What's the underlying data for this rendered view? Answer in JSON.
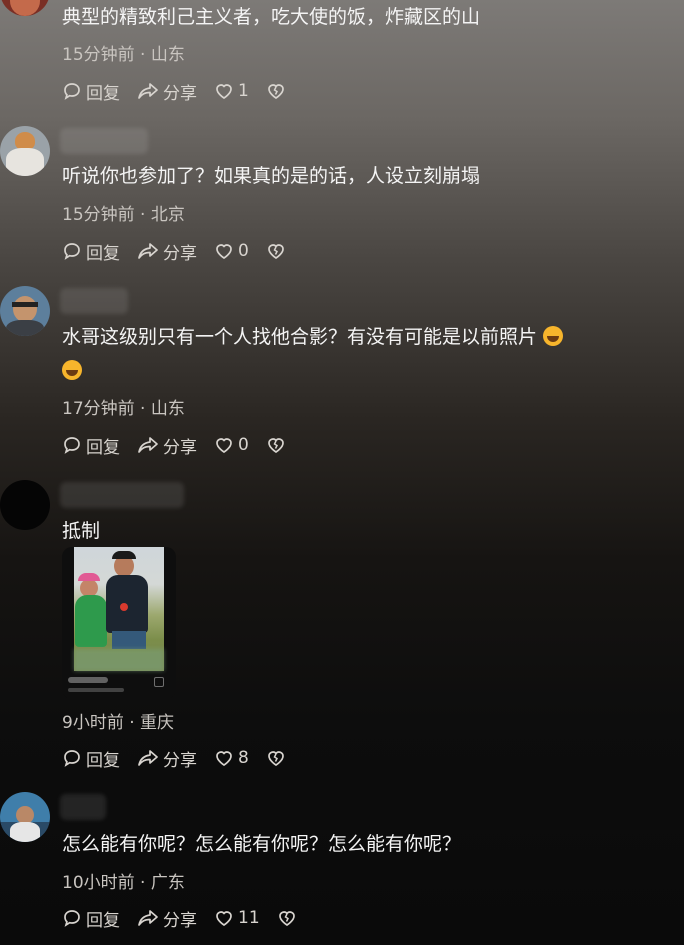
{
  "actions": {
    "reply": "回复",
    "share": "分享"
  },
  "comments": [
    {
      "text": "典型的精致利己主义者，吃大使的饭，炸藏区的山",
      "time": "15分钟前",
      "location": "山东",
      "likes": "1"
    },
    {
      "text": "听说你也参加了？如果真的是的话，人设立刻崩塌",
      "time": "15分钟前",
      "location": "北京",
      "likes": "0"
    },
    {
      "text": "水哥这级别只有一个人找他合影？有没有可能是以前照片",
      "time": "17分钟前",
      "location": "山东",
      "likes": "0"
    },
    {
      "text": "抵制",
      "time": "9小时前",
      "location": "重庆",
      "likes": "8"
    },
    {
      "text": "怎么能有你呢？怎么能有你呢？怎么能有你呢？",
      "time": "10小时前",
      "location": "广东",
      "likes": "11"
    }
  ],
  "colors": {
    "accent": "#f7b52c"
  }
}
